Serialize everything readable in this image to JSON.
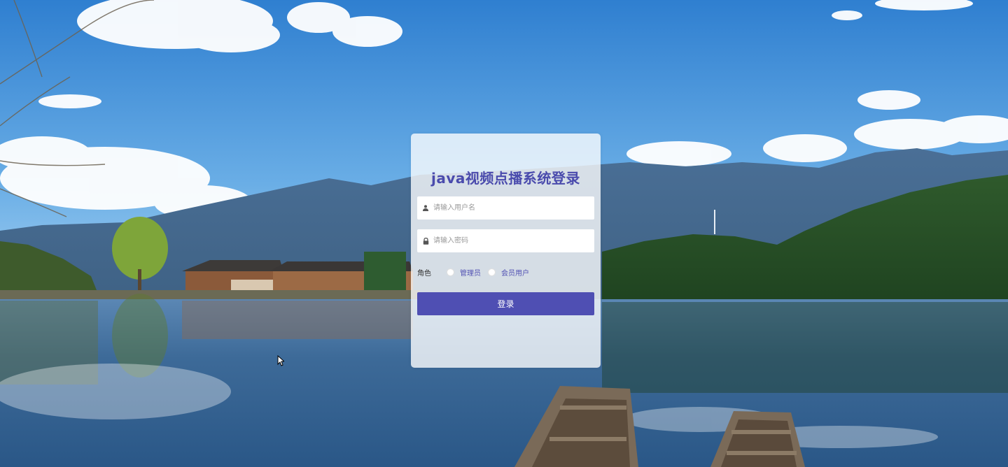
{
  "login": {
    "title": "java视频点播系统登录",
    "username_placeholder": "请输入用户名",
    "password_placeholder": "请输入密码",
    "role_label": "角色",
    "roles": [
      "管理员",
      "会员用户"
    ],
    "submit_label": "登录"
  },
  "colors": {
    "accent": "#4f4fb3",
    "title": "#4a4bad",
    "sky_top": "#3a86d4",
    "lake": "#2f5f8e"
  },
  "icons": {
    "user_field": "user-icon",
    "password_field": "lock-icon"
  }
}
